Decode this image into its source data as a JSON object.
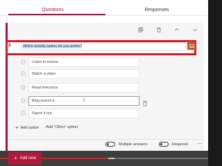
{
  "tabs": [
    {
      "label": "Questions",
      "active": true
    },
    {
      "label": "Responses",
      "active": false
    }
  ],
  "toolbar": {
    "icons": [
      "copy-icon",
      "delete-icon",
      "move-up-icon",
      "move-down-icon"
    ]
  },
  "question": {
    "number": "2.",
    "text": "Which activity option do you prefer?",
    "image_button_icon": "insert-image-icon"
  },
  "options": [
    {
      "label": "Listen to lecture"
    },
    {
      "label": "Watch a video"
    },
    {
      "label": "Read directions"
    },
    {
      "label": "Bing search it"
    },
    {
      "label": "Figure it out"
    }
  ],
  "actions": {
    "add_option": "Add option",
    "add_other": "Add \"Other\" option"
  },
  "settings": {
    "multiple_answers": "Multiple answers",
    "required": "Required"
  },
  "bottom": {
    "add_new": "Add new",
    "progress": 0.52,
    "buffer": 0.55
  },
  "colors": {
    "accent": "#a7133d",
    "highlight_border": "#d11a2a",
    "image_button": "#c4532a"
  }
}
